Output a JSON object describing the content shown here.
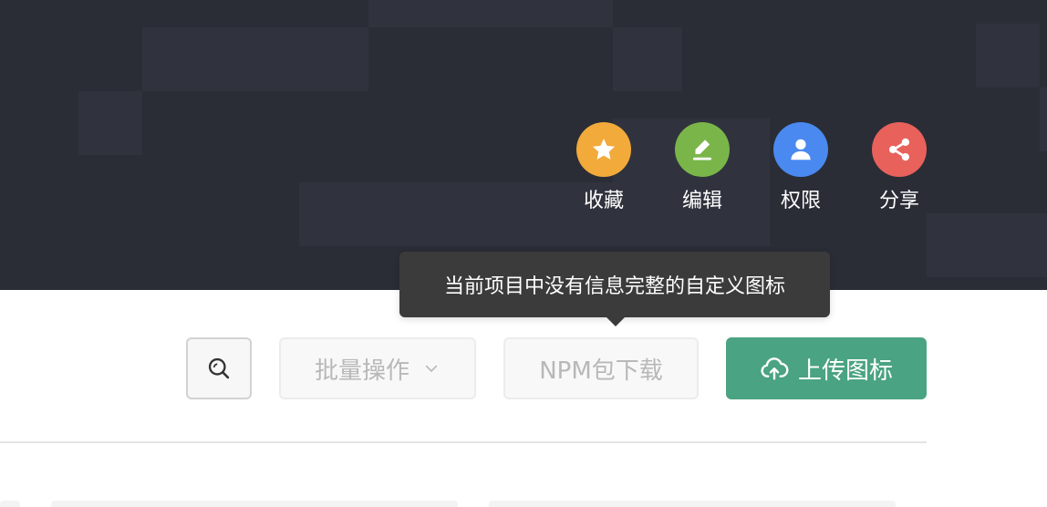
{
  "colors": {
    "hero_bg": "#2a2d36",
    "tile_bg": "#30333d",
    "favorite": "#f2aa3b",
    "edit": "#7ab54a",
    "permission": "#4a89f0",
    "share": "#e8615b",
    "primary": "#4aa382"
  },
  "actions": [
    {
      "label": "收藏",
      "icon": "star-icon",
      "color": "#f2aa3b"
    },
    {
      "label": "编辑",
      "icon": "pencil-icon",
      "color": "#7ab54a"
    },
    {
      "label": "权限",
      "icon": "user-icon",
      "color": "#4a89f0"
    },
    {
      "label": "分享",
      "icon": "share-icon",
      "color": "#e8615b"
    }
  ],
  "tooltip": {
    "text": "当前项目中没有信息完整的自定义图标"
  },
  "toolbar": {
    "search_icon": "search-icon",
    "batch_label": "批量操作",
    "batch_icon": "chevron-down-icon",
    "npm_label": "NPM包下载",
    "upload_label": "上传图标",
    "upload_icon": "cloud-upload-icon"
  }
}
